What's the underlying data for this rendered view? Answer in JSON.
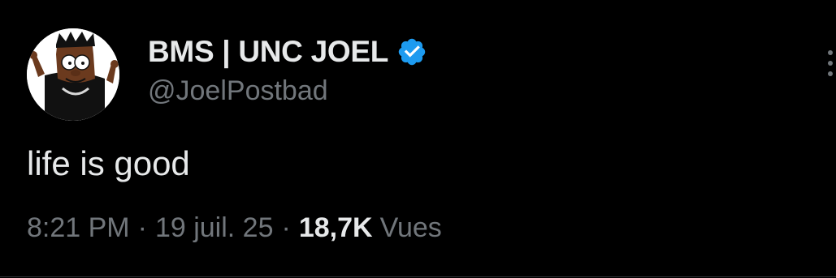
{
  "tweet": {
    "author": {
      "display_name": "BMS | UNC JOEL",
      "handle": "@JoelPostbad",
      "verified": true,
      "avatar_icon": "cartoon-character-avatar"
    },
    "text": "life is good",
    "time": "8:21 PM",
    "separator": "·",
    "date": "19 juil. 25",
    "views_count": "18,7K",
    "views_label": "Vues"
  },
  "colors": {
    "background": "#000000",
    "primary_text": "#e7e9ea",
    "secondary_text": "#71767b",
    "verified_blue": "#1d9bf0",
    "divider": "#2f3336"
  },
  "icons": {
    "verified": "verified-badge-icon",
    "more": "more-options-icon"
  }
}
